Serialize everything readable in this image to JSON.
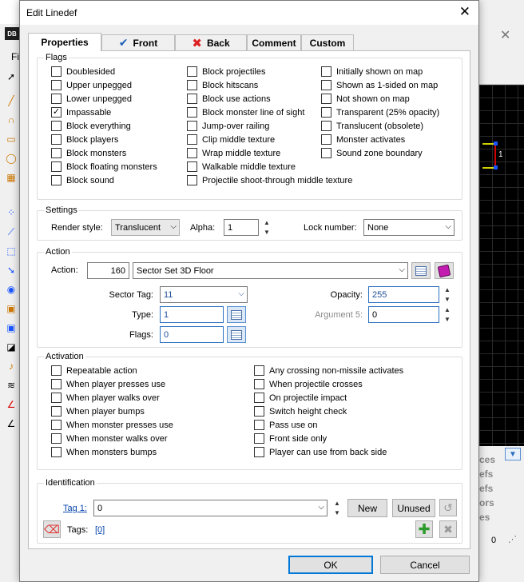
{
  "background": {
    "logo": "DB",
    "menu_fragment": "Fi",
    "map_number": "1",
    "list_fragments": [
      "ces",
      "efs",
      "efs",
      "ors",
      "es"
    ],
    "status_value": "0",
    "map_colors": {
      "line": "#d4d400",
      "selected_line": "#d00000",
      "vertex": "#1a56ff"
    }
  },
  "dialog": {
    "title": "Edit Linedef",
    "tabs": [
      {
        "label": "Properties",
        "icon": ""
      },
      {
        "label": "Front",
        "icon": "check-icon"
      },
      {
        "label": "Back",
        "icon": "x-icon"
      },
      {
        "label": "Comment",
        "icon": ""
      },
      {
        "label": "Custom",
        "icon": ""
      }
    ],
    "active_tab": "Properties"
  },
  "flags": {
    "legend": "Flags",
    "col1": [
      {
        "label": "Doublesided",
        "checked": false
      },
      {
        "label": "Upper unpegged",
        "checked": false
      },
      {
        "label": "Lower unpegged",
        "checked": false
      },
      {
        "label": "Impassable",
        "checked": true
      },
      {
        "label": "Block everything",
        "checked": false
      },
      {
        "label": "Block players",
        "checked": false
      },
      {
        "label": "Block monsters",
        "checked": false
      },
      {
        "label": "Block floating monsters",
        "checked": false
      },
      {
        "label": "Block sound",
        "checked": false
      }
    ],
    "col2": [
      {
        "label": "Block projectiles",
        "checked": false
      },
      {
        "label": "Block hitscans",
        "checked": false
      },
      {
        "label": "Block use actions",
        "checked": false
      },
      {
        "label": "Block monster line of sight",
        "checked": false
      },
      {
        "label": "Jump-over railing",
        "checked": false
      },
      {
        "label": "Clip middle texture",
        "checked": false
      },
      {
        "label": "Wrap middle texture",
        "checked": false
      },
      {
        "label": "Walkable middle texture",
        "checked": false
      },
      {
        "label": "Projectile shoot-through middle texture",
        "checked": false
      }
    ],
    "col3": [
      {
        "label": "Initially shown on map",
        "checked": false
      },
      {
        "label": "Shown as 1-sided on map",
        "checked": false
      },
      {
        "label": "Not shown on map",
        "checked": false
      },
      {
        "label": "Transparent (25% opacity)",
        "checked": false
      },
      {
        "label": "Translucent (obsolete)",
        "checked": false
      },
      {
        "label": "Monster activates",
        "checked": false
      },
      {
        "label": "Sound zone boundary",
        "checked": false
      }
    ]
  },
  "settings": {
    "legend": "Settings",
    "render_style_label": "Render style:",
    "render_style_value": "Translucent",
    "alpha_label": "Alpha:",
    "alpha_value": "1",
    "lock_label": "Lock number:",
    "lock_value": "None"
  },
  "action": {
    "legend": "Action",
    "action_label": "Action:",
    "action_number": "160",
    "action_name": "Sector Set 3D Floor",
    "sector_tag_label": "Sector Tag:",
    "sector_tag_value": "11",
    "type_label": "Type:",
    "type_value": "1",
    "flags_label": "Flags:",
    "flags_value": "0",
    "opacity_label": "Opacity:",
    "opacity_value": "255",
    "arg5_label": "Argument 5:",
    "arg5_value": "0"
  },
  "activation": {
    "legend": "Activation",
    "col1": [
      {
        "label": "Repeatable action",
        "checked": false
      },
      {
        "label": "When player presses use",
        "checked": false
      },
      {
        "label": "When player walks over",
        "checked": false
      },
      {
        "label": "When player bumps",
        "checked": false
      },
      {
        "label": "When monster presses use",
        "checked": false
      },
      {
        "label": "When monster walks over",
        "checked": false
      },
      {
        "label": "When monsters bumps",
        "checked": false
      }
    ],
    "col2": [
      {
        "label": "Any crossing non-missile activates",
        "checked": false
      },
      {
        "label": "When projectile crosses",
        "checked": false
      },
      {
        "label": "On projectile impact",
        "checked": false
      },
      {
        "label": "Switch height check",
        "checked": false
      },
      {
        "label": "Pass use on",
        "checked": false
      },
      {
        "label": "Front side only",
        "checked": false
      },
      {
        "label": "Player can use from back side",
        "checked": false
      }
    ]
  },
  "identification": {
    "legend": "Identification",
    "tag_label": "Tag 1:",
    "tag_value": "0",
    "new_label": "New",
    "unused_label": "Unused",
    "tags_label": "Tags:",
    "tags_link": "[0]"
  },
  "buttons": {
    "ok": "OK",
    "cancel": "Cancel"
  }
}
